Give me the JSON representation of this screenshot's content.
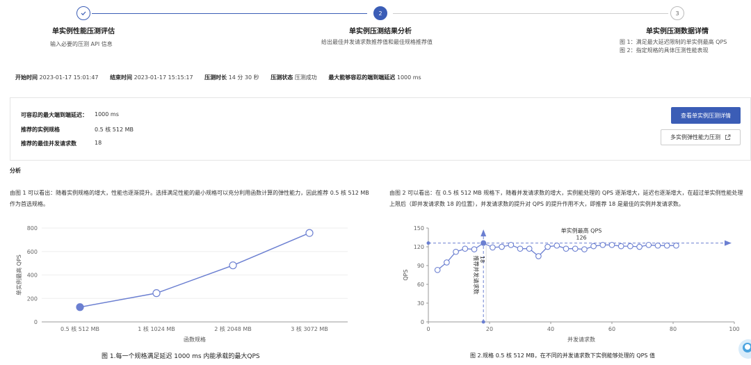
{
  "steps": [
    {
      "icon": "check",
      "title": "单实例性能压测评估",
      "desc": [
        "输入必要的压测 API 信息"
      ]
    },
    {
      "number": "2",
      "title": "单实例压测结果分析",
      "desc": [
        "给出最佳并发请求数推荐值和最佳规格推荐值"
      ]
    },
    {
      "number": "3",
      "title": "单实例压测数据详情",
      "desc": [
        "图 1：满足最大延迟限制的单实例最高 QPS",
        "图 2：指定规格的具体压测性能表现"
      ]
    }
  ],
  "info": {
    "start_label": "开始时间",
    "start_value": "2023-01-17 15:01:47",
    "end_label": "结束时间",
    "end_value": "2023-01-17 15:15:17",
    "duration_label": "压测时长",
    "duration_value": "14 分 30 秒",
    "status_label": "压测状态",
    "status_value": "压测成功",
    "max_latency_label": "最大能够容忍的端到端延迟",
    "max_latency_value": "1000 ms"
  },
  "summary": {
    "latency_label": "可容忍的最大端到端延迟：",
    "latency_value": "1000 ms",
    "spec_label": "推荐的实例规格",
    "spec_value": "0.5 核 512 MB",
    "concurrency_label": "推荐的最佳并发请求数",
    "concurrency_value": "18",
    "detail_button": "查看单实例压测详情",
    "multi_button": "多实例弹性能力压测"
  },
  "analysis": {
    "label": "分析",
    "left_text": "由图 1 可以看出：随着实例规格的增大，性能也逐渐提升。选择满足性能的最小规格可以充分利用函数计算的弹性能力，因此推荐 0.5 核 512 MB 作为首选规格。",
    "right_text": "由图 2 可以看出：在 0.5 核 512 MB 规格下，随着并发请求数的增大，实例能处理的 QPS 逐渐增大，延迟也逐渐增大，在超过单实例性能处理上限后（即并发请求数 18 的位置），并发请求数的提升对 QPS 的提升作用不大，即推荐 18 是最佳的实例并发请求数。"
  },
  "colors": {
    "accent": "#3b5db6",
    "line": "#6b7fd1"
  },
  "chart_data": [
    {
      "type": "line",
      "categories": [
        "0.5 核 512 MB",
        "1 核 1024 MB",
        "2 核 2048 MB",
        "3 核 3072 MB"
      ],
      "series": [
        {
          "values": [
            126,
            245,
            482,
            758
          ]
        }
      ],
      "xlabel": "函数规格",
      "ylabel": "单实例最高 QPS",
      "ylim": [
        0,
        800
      ],
      "yticks": [
        "0",
        "200",
        "400",
        "600",
        "800"
      ],
      "caption": "图 1.每一个规格满足延迟 1000 ms 内能承载的最大QPS",
      "grid": true
    },
    {
      "type": "line",
      "x": [
        3,
        6,
        9,
        12,
        15,
        18,
        21,
        24,
        27,
        30,
        33,
        36,
        39,
        42,
        45,
        48,
        51,
        54,
        57,
        60,
        63,
        66,
        69,
        72,
        75,
        78,
        81
      ],
      "series": [
        {
          "values": [
            83,
            95,
            112,
            117,
            116,
            126,
            119,
            120,
            123,
            117,
            117,
            105,
            120,
            122,
            117,
            117,
            116,
            121,
            123,
            123,
            121,
            121,
            120,
            123,
            122,
            122,
            122
          ]
        }
      ],
      "xlabel": "并发请求数",
      "ylabel": "QPS",
      "xlim": [
        0,
        100
      ],
      "ylim": [
        0,
        150
      ],
      "xticks": [
        "0",
        "20",
        "40",
        "60",
        "80",
        "100"
      ],
      "yticks": [
        "0",
        "30",
        "60",
        "90",
        "120",
        "150"
      ],
      "annotation_max_label": "单实例最高 QPS",
      "annotation_max_value": "126",
      "annotation_rec_label": "推荐并发请求数",
      "annotation_rec_value": "18",
      "caption": "图 2.规格 0.5 核 512 MB，在不同的并发请求数下实例能够处理的 QPS 值",
      "grid": false
    }
  ]
}
